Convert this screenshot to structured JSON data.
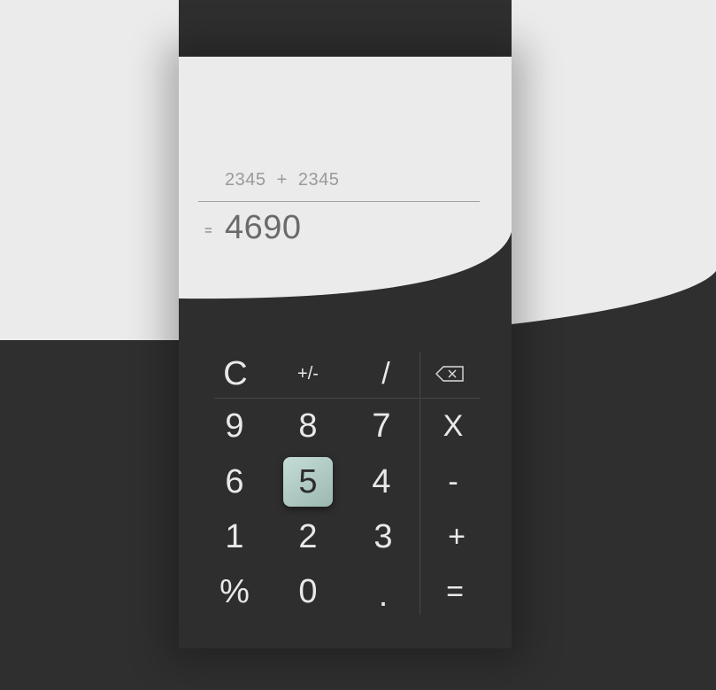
{
  "display": {
    "expression": "2345  +  2345",
    "equals_sign": "=",
    "result": "4690"
  },
  "keypad": {
    "clear": "C",
    "negate": "+/-",
    "divide": "/",
    "backspace_icon": "backspace-icon",
    "multiply": "X",
    "subtract": "-",
    "add": "+",
    "equals": "=",
    "percent": "%",
    "decimal": ".",
    "digits": {
      "zero": "0",
      "one": "1",
      "two": "2",
      "three": "3",
      "four": "4",
      "five": "5",
      "six": "6",
      "seven": "7",
      "eight": "8",
      "nine": "9"
    },
    "active_key": "5"
  },
  "colors": {
    "display_background": "#ebebeb",
    "keypad_background": "#2e2e2e",
    "key_text": "#e9e9e9",
    "active_key_accent": "#b3cdc6",
    "result_text": "#6a6a6a"
  }
}
